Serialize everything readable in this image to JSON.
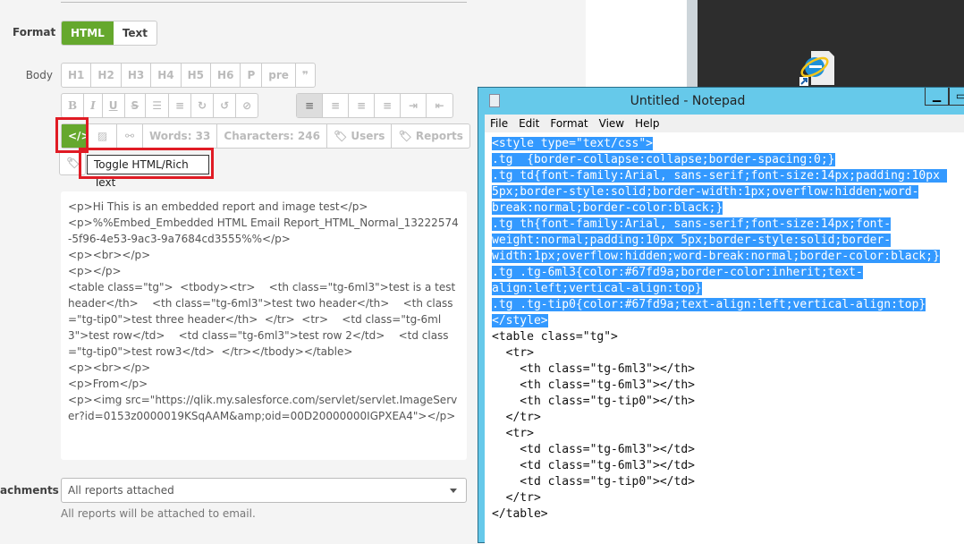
{
  "form": {
    "format_label": "Format",
    "format_options": [
      "HTML",
      "Text"
    ],
    "body_label": "Body",
    "headings": [
      "H1",
      "H2",
      "H3",
      "H4",
      "H5",
      "H6",
      "P",
      "pre",
      "❞"
    ],
    "formatting": [
      "B",
      "I",
      "U",
      "S",
      "☰",
      "≡",
      "↻",
      "↺",
      "⊘"
    ],
    "align": [
      "≡",
      "≡",
      "≡",
      "≡",
      "⇥",
      "⇤"
    ],
    "code_toggle": "</>",
    "words": "Words: 33",
    "characters": "Characters: 246",
    "users": "Users",
    "reports": "Reports",
    "tooltip": "Toggle HTML/Rich Text",
    "body_lines": [
      "<p>Hi This is an embedded report and image test</p>",
      "<p>%%Embed_Embedded HTML Email Report_HTML_Normal_13222574-5f96-4e53-9ac3-9a7684cd3555%%</p>",
      "<p><br></p>",
      "<p></p>",
      "<table class=\"tg\">  <tbody><tr>    <th class=\"tg-6ml3\">test is a test header</th>    <th class=\"tg-6ml3\">test two header</th>    <th class=\"tg-tip0\">test three header</th>  </tr>  <tr>    <td class=\"tg-6ml3\">test row</td>    <td class=\"tg-6ml3\">test row 2</td>    <td class=\"tg-tip0\">test row3</td>  </tr></tbody></table>",
      "<p><br></p>",
      "<p>From</p>",
      "<p><img src=\"https://qlik.my.salesforce.com/servlet/servlet.ImageServer?id=0153z0000019KSqAAM&amp;oid=00D20000000IGPXEA4\"></p>"
    ],
    "attachments_label": "achments",
    "attachments_value": "All reports attached",
    "attachments_hint": "All reports will be attached to email."
  },
  "notepad": {
    "title": "Untitled - Notepad",
    "menu": [
      "File",
      "Edit",
      "Format",
      "View",
      "Help"
    ],
    "selected_lines": [
      "<style type=\"text/css\">",
      ".tg  {border-collapse:collapse;border-spacing:0;}",
      ".tg td{font-family:Arial, sans-serif;font-size:14px;padding:10px ",
      "5px;border-style:solid;border-width:1px;overflow:hidden;word-",
      "break:normal;border-color:black;}",
      ".tg th{font-family:Arial, sans-serif;font-size:14px;font-",
      "weight:normal;padding:10px 5px;border-style:solid;border-",
      "width:1px;overflow:hidden;word-break:normal;border-color:black;}",
      ".tg .tg-6ml3{color:#67fd9a;border-color:inherit;text-",
      "align:left;vertical-align:top}",
      ".tg .tg-tip0{color:#67fd9a;text-align:left;vertical-align:top}",
      "</style>"
    ],
    "lines": [
      "<table class=\"tg\">",
      "  <tr>",
      "    <th class=\"tg-6ml3\"></th>",
      "    <th class=\"tg-6ml3\"></th>",
      "    <th class=\"tg-tip0\"></th>",
      "  </tr>",
      "  <tr>",
      "    <td class=\"tg-6ml3\"></td>",
      "    <td class=\"tg-6ml3\"></td>",
      "    <td class=\"tg-tip0\"></td>",
      "  </tr>",
      "</table>"
    ]
  },
  "colors": {
    "accent": "#65a82d",
    "highlight": "#e01b24",
    "selection": "#3399ff",
    "titlebar": "#66c9ea"
  }
}
